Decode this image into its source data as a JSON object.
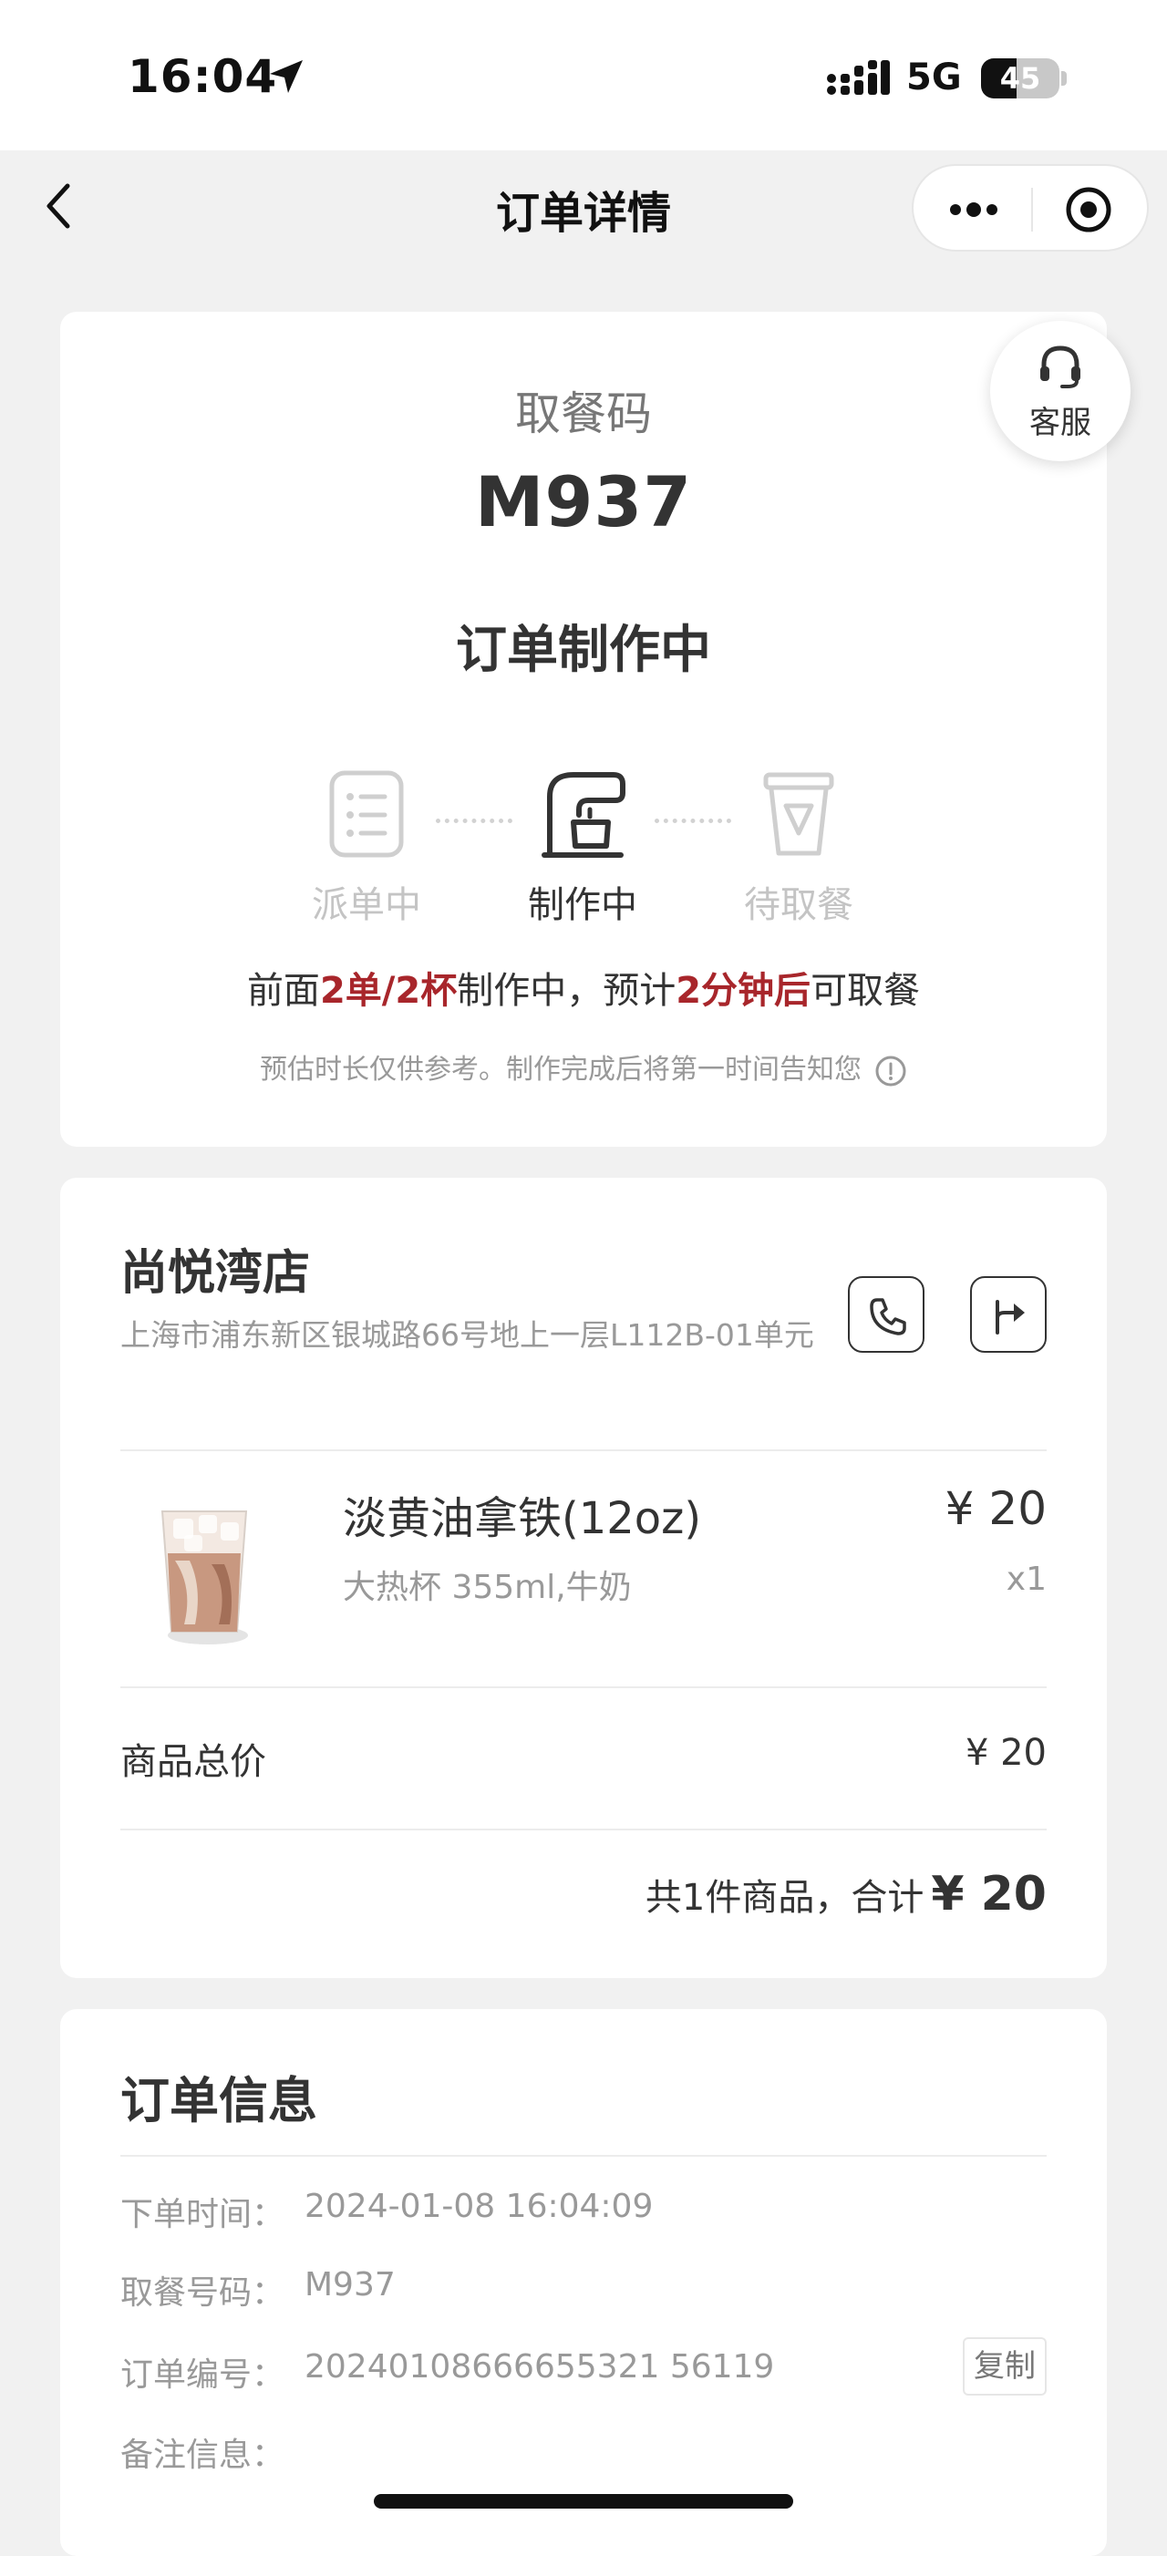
{
  "status_bar": {
    "time": "16:04",
    "network": "5G",
    "battery": "45",
    "battery_level": 0.45
  },
  "nav": {
    "title": "订单详情"
  },
  "pickup": {
    "label": "取餐码",
    "code": "M937",
    "status": "订单制作中",
    "steps": [
      {
        "label": "派单中",
        "icon": "order-list-icon",
        "active": false
      },
      {
        "label": "制作中",
        "icon": "coffee-machine-icon",
        "active": true
      },
      {
        "label": "待取餐",
        "icon": "cup-icon",
        "active": false
      }
    ],
    "progress": {
      "prefix": "前面",
      "queue": "2单/2杯",
      "middle": "制作中，预计",
      "eta": "2分钟后",
      "suffix": "可取餐"
    },
    "tip": "预估时长仅供参考。制作完成后将第一时间告知您",
    "service_label": "客服"
  },
  "store": {
    "name": "尚悦湾店",
    "address": "上海市浦东新区银城路66号地上一层L112B-01单元"
  },
  "item": {
    "name": "淡黄油拿铁(12oz)",
    "options": "大热杯 355ml,牛奶",
    "price": "¥ 20",
    "qty": "x1"
  },
  "summary": {
    "subtotal_label": "商品总价",
    "subtotal_value": "¥ 20",
    "total_text": "共1件商品，合计",
    "total_amount": "¥ 20"
  },
  "order_info": {
    "title": "订单信息",
    "rows": [
      {
        "key": "下单时间：",
        "value": "2024-01-08 16:04:09"
      },
      {
        "key": "取餐号码：",
        "value": "M937"
      },
      {
        "key": "订单编号：",
        "value": "20240108666655321 56119"
      },
      {
        "key": "备注信息：",
        "value": ""
      }
    ],
    "copy_label": "复制"
  }
}
